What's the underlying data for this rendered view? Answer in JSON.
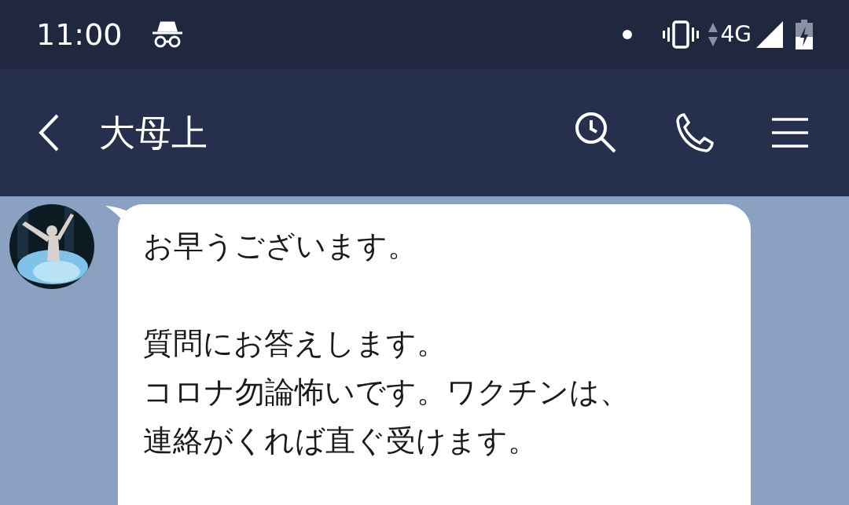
{
  "status_bar": {
    "time": "11:00",
    "network": "4G"
  },
  "header": {
    "title": "大母上"
  },
  "messages": [
    {
      "avatar": {
        "kind": "picture"
      },
      "paragraphs": [
        [
          "お早うございます。"
        ],
        [
          "質問にお答えします。",
          "コロナ勿論怖いです。ワクチンは、",
          "連絡がくれば直ぐ受けます。"
        ]
      ]
    }
  ]
}
